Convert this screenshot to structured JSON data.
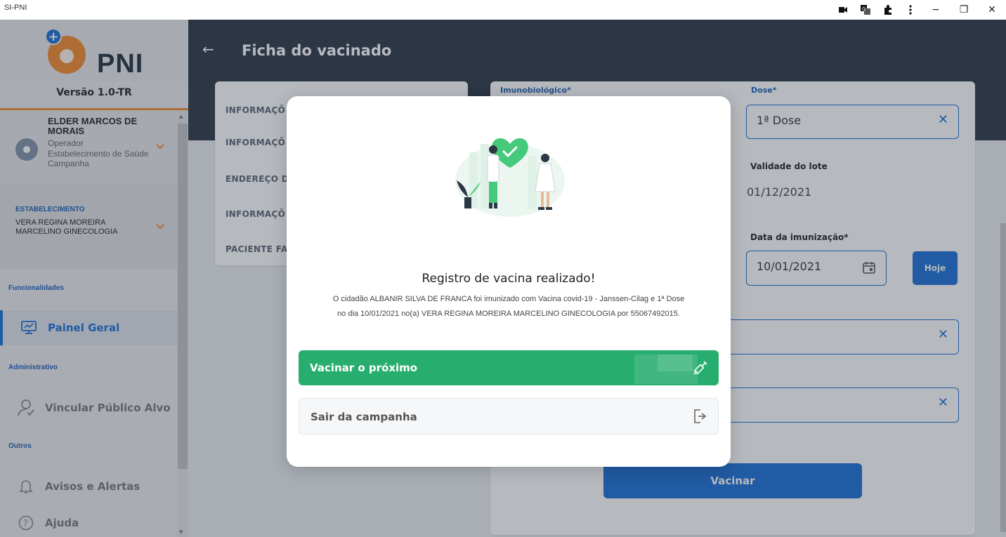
{
  "window": {
    "title": "SI-PNI",
    "ctrl_icons": [
      "camera-icon",
      "translate-icon",
      "extensions-icon",
      "more-icon"
    ],
    "minimize": "−",
    "restore": "❐",
    "close": "✕"
  },
  "sidebar": {
    "logo_text": "PNI",
    "version": "Versão 1.0-TR",
    "user": {
      "name": "ELDER MARCOS DE MORAIS",
      "role": "Operador",
      "unit": "Estabelecimento de Saúde Campanha"
    },
    "establishment": {
      "label": "ESTABELECIMENTO",
      "name": "VERA REGINA MOREIRA MARCELINO GINECOLOGIA"
    },
    "sections": {
      "funcionalidades": "Funcionalidades",
      "administrativo": "Administrativo",
      "outros": "Outros"
    },
    "items": {
      "painel_geral": "Painel Geral",
      "vincular": "Vincular Público Alvo",
      "avisos": "Avisos e Alertas",
      "ajuda": "Ajuda"
    }
  },
  "header": {
    "back": "←",
    "title": "Ficha do vacinado"
  },
  "left_card": {
    "items": [
      "INFORMAÇÕ",
      "INFORMAÇÕ",
      "ENDEREÇO D",
      "INFORMAÇÕ",
      "PACIENTE FA"
    ]
  },
  "form": {
    "imunobiologico_label": "Imunobiológico*",
    "dose_label": "Dose*",
    "dose_value": "1ª Dose",
    "validade_label": "Validade do lote",
    "validade_value": "01/12/2021",
    "data_label": "Data da imunização*",
    "data_value": "10/01/2021",
    "hoje_label": "Hoje",
    "vacinar_label": "Vacinar"
  },
  "modal": {
    "title": "Registro de vacina realizado!",
    "message_line1": "O cidadão ALBANIR SILVA DE FRANCA foi imunizado com Vacina covid-19 - Janssen-Cilag e 1ª Dose",
    "message_line2": "no dia 10/01/2021 no(a) VERA REGINA MOREIRA MARCELINO GINECOLOGIA por 55067492015.",
    "next_label": "Vacinar o próximo",
    "exit_label": "Sair da campanha"
  },
  "colors": {
    "header": "#2b3744",
    "primary": "#1a6fd6",
    "accent": "#f28b2c",
    "success": "#27ae6e"
  }
}
